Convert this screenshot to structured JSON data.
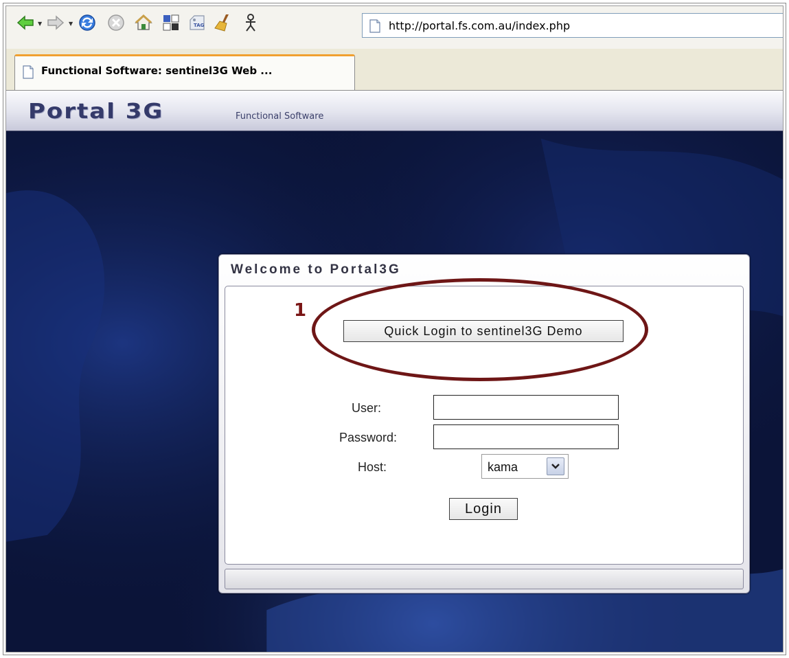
{
  "toolbar": {
    "buttons": [
      {
        "name": "back-icon"
      },
      {
        "name": "forward-icon"
      },
      {
        "name": "reload-icon"
      },
      {
        "name": "stop-icon"
      },
      {
        "name": "home-icon"
      },
      {
        "name": "tiles-icon"
      },
      {
        "name": "tag-icon"
      },
      {
        "name": "broom-icon"
      },
      {
        "name": "user-icon"
      }
    ],
    "tag_badge": "TAG",
    "url": "http://portal.fs.com.au/index.php"
  },
  "tabs": [
    {
      "label": "Functional Software: sentinel3G Web ..."
    }
  ],
  "header": {
    "logo": "Portal 3G",
    "subtitle": "Functional Software"
  },
  "login": {
    "title": "Welcome to Portal3G",
    "annotation": "1",
    "quick_login_label": "Quick Login to sentinel3G Demo",
    "user_label": "User:",
    "password_label": "Password:",
    "host_label": "Host:",
    "host_value": "kama",
    "login_label": "Login"
  },
  "colors": {
    "annotation": "#6e1616",
    "background": "#0b1438",
    "accent_tab": "#f0a030"
  }
}
